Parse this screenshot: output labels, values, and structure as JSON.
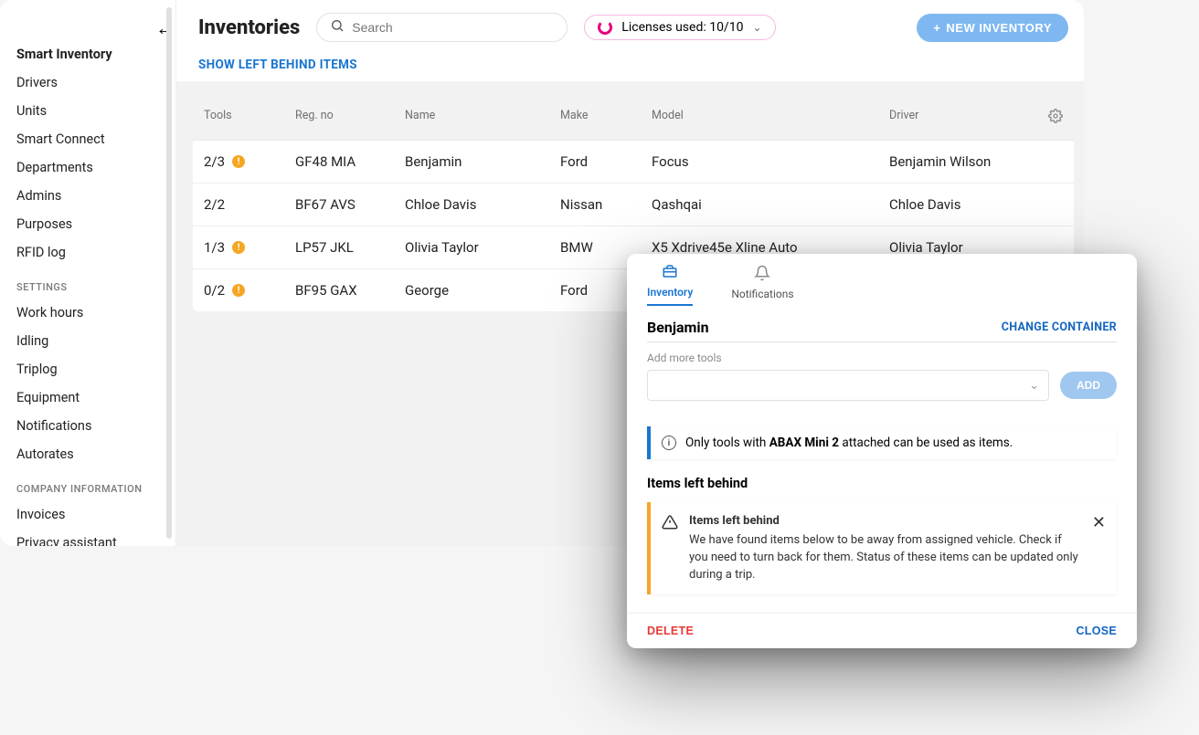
{
  "sidebar": {
    "back_icon": "←",
    "main": [
      "Smart Inventory",
      "Drivers",
      "Units",
      "Smart Connect",
      "Departments",
      "Admins",
      "Purposes",
      "RFID log"
    ],
    "settings_label": "SETTINGS",
    "settings": [
      "Work hours",
      "Idling",
      "Triplog",
      "Equipment",
      "Notifications",
      "Autorates"
    ],
    "company_label": "COMPANY INFORMATION",
    "company": [
      "Invoices",
      "Privacy assistant"
    ]
  },
  "header": {
    "title": "Inventories",
    "search_placeholder": "Search",
    "licenses_label": "Licenses used: 10/10",
    "new_inventory": "NEW INVENTORY",
    "show_left_behind": "SHOW LEFT BEHIND ITEMS"
  },
  "table": {
    "cols": [
      "Tools",
      "Reg. no",
      "Name",
      "Make",
      "Model",
      "Driver"
    ],
    "rows": [
      {
        "tools": "2/3",
        "warn": true,
        "reg": "GF48 MIA",
        "name": "Benjamin",
        "make": "Ford",
        "model": "Focus",
        "driver": "Benjamin Wilson"
      },
      {
        "tools": "2/2",
        "warn": false,
        "reg": "BF67 AVS",
        "name": "Chloe Davis",
        "make": "Nissan",
        "model": "Qashqai",
        "driver": "Chloe Davis"
      },
      {
        "tools": "1/3",
        "warn": true,
        "reg": "LP57 JKL",
        "name": "Olivia Taylor",
        "make": "BMW",
        "model": "X5 Xdrive45e Xline Auto",
        "driver": "Olivia Taylor"
      },
      {
        "tools": "0/2",
        "warn": true,
        "reg": "BF95 GAX",
        "name": "George",
        "make": "Ford",
        "model": "",
        "driver": ""
      }
    ]
  },
  "panel": {
    "tabs": {
      "inventory": "Inventory",
      "notifications": "Notifications"
    },
    "name": "Benjamin",
    "change": "CHANGE CONTAINER",
    "add_label": "Add more tools",
    "add_btn": "ADD",
    "info_prefix": "Only tools with ",
    "info_bold": "ABAX Mini 2",
    "info_suffix": " attached can be used as items.",
    "section": "Items left behind",
    "warn_title": "Items left behind",
    "warn_body": "We have found items below to be away from assigned vehicle. Check if you need to turn back for them. Status of these items can be updated only during a trip.",
    "delete": "DELETE",
    "close": "CLOSE"
  }
}
